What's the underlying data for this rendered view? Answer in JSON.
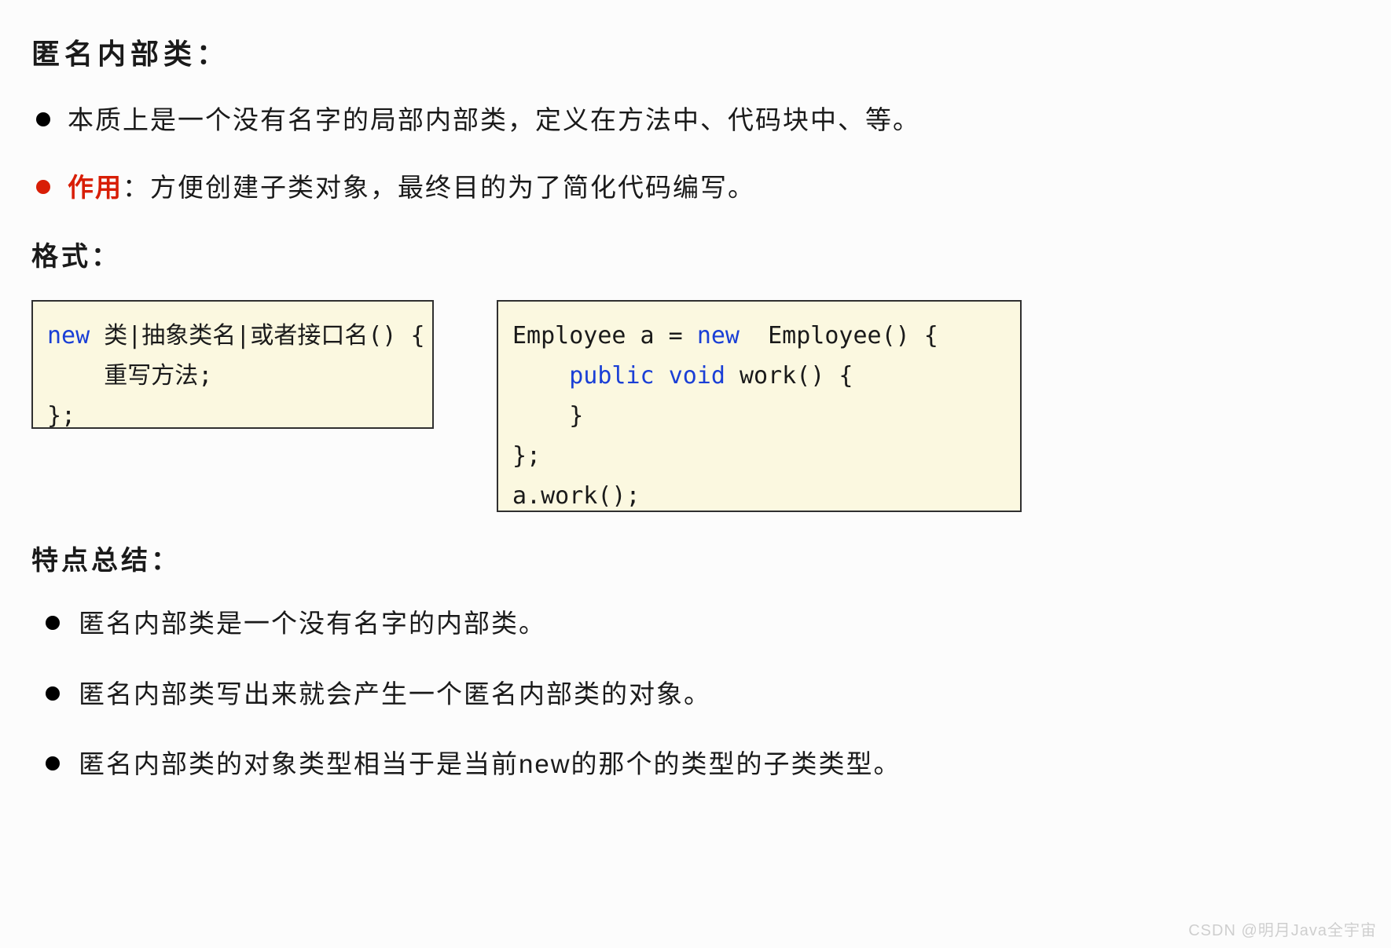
{
  "headings": {
    "title": "匿名内部类：",
    "format": "格式：",
    "summary": "特点总结："
  },
  "intro_bullets": [
    {
      "text": "本质上是一个没有名字的局部内部类，定义在方法中、代码块中、等。"
    }
  ],
  "purpose": {
    "label": "作用",
    "text": "：方便创建子类对象，最终目的为了简化代码编写。"
  },
  "code_left": {
    "kw_new": "new",
    "line1_rest": " 类|抽象类名|或者接口名() {",
    "line2": "    重写方法;",
    "line3": "};"
  },
  "code_right": {
    "line1_a": "Employee a = ",
    "kw_new": "new",
    "line1_b": "  Employee() {",
    "line2_indent": "    ",
    "kw_public": "public",
    "kw_void": "void",
    "line2_rest": " work() {",
    "line3": "    }",
    "line4": "};",
    "line5": "a.work();"
  },
  "summary_bullets": [
    "匿名内部类是一个没有名字的内部类。",
    "匿名内部类写出来就会产生一个匿名内部类的对象。",
    "匿名内部类的对象类型相当于是当前new的那个的类型的子类类型。"
  ],
  "watermark": "CSDN @明月Java全宇宙"
}
